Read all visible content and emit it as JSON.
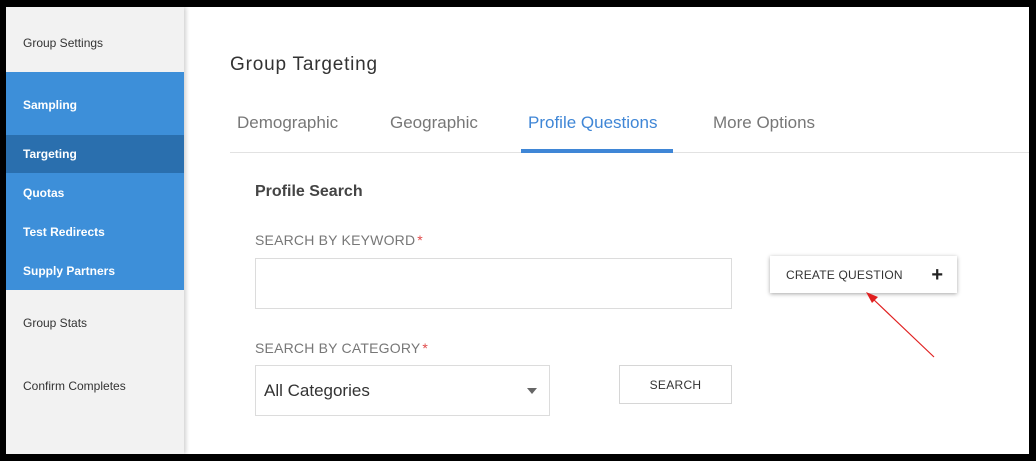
{
  "sidebar": {
    "top_items": [
      {
        "label": "Group Settings"
      }
    ],
    "blue_items": [
      {
        "label": "Sampling"
      },
      {
        "label": "Targeting"
      },
      {
        "label": "Quotas"
      },
      {
        "label": "Test Redirects"
      },
      {
        "label": "Supply Partners"
      }
    ],
    "bottom_items": [
      {
        "label": "Group Stats"
      },
      {
        "label": "Confirm Completes"
      }
    ],
    "active": "Targeting"
  },
  "header": {
    "title": "Group Targeting"
  },
  "tabs": [
    {
      "label": "Demographic"
    },
    {
      "label": "Geographic"
    },
    {
      "label": "Profile Questions"
    },
    {
      "label": "More Options"
    }
  ],
  "active_tab": "Profile Questions",
  "profile_search": {
    "title": "Profile Search",
    "keyword_label": "SEARCH BY KEYWORD",
    "keyword_value": "",
    "required_mark": "*",
    "category_label": "SEARCH BY CATEGORY",
    "category_value": "All Categories",
    "create_question_label": "CREATE QUESTION",
    "create_question_icon": "+",
    "search_button_label": "SEARCH"
  },
  "colors": {
    "sidebar_blue": "#3d8fd9",
    "sidebar_active": "#2a6fae",
    "tab_active": "#3f86d6",
    "required": "#e04a4a",
    "annotation_arrow": "#e02020"
  }
}
